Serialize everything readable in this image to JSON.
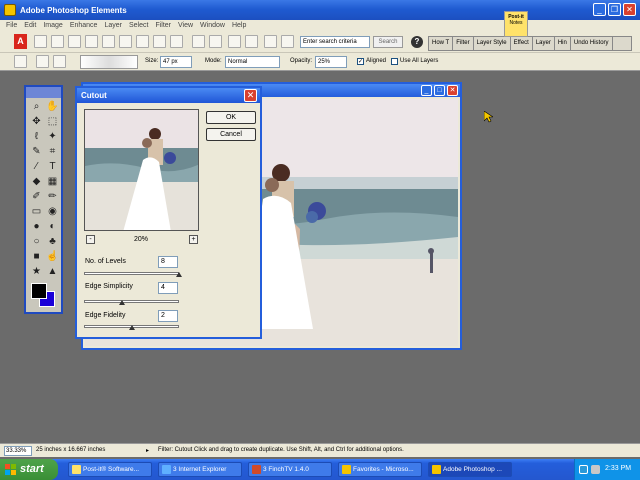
{
  "window": {
    "title": "Adobe Photoshop Elements"
  },
  "postit": {
    "label": "Post-it",
    "sub": "Notes"
  },
  "menubar": {
    "items": [
      "File",
      "Edit",
      "Image",
      "Enhance",
      "Layer",
      "Select",
      "Filter",
      "View",
      "Window",
      "Help"
    ]
  },
  "toolbar": {
    "search_placeholder": "Enter search criteria",
    "search_button": "Search",
    "help_glyph": "?",
    "palette_tabs": [
      "How T",
      "Filter",
      "Layer Style",
      "Effect",
      "Layer",
      "Hin",
      "Undo History"
    ]
  },
  "options": {
    "size_label": "Size:",
    "size_value": "47 px",
    "mode_label": "Mode:",
    "mode_value": "Normal",
    "opacity_label": "Opacity:",
    "opacity_value": "25%",
    "aligned_label": "Aligned",
    "aligned_checked": true,
    "use_all_layers_label": "Use All Layers",
    "use_all_layers_checked": false
  },
  "toolbox": {
    "tools": [
      "zoom-tool-icon",
      "hand-tool-icon",
      "move-tool-icon",
      "marquee-tool-icon",
      "lasso-tool-icon",
      "magic-wand-tool-icon",
      "selection-brush-icon",
      "crop-tool-icon",
      "eyedropper-icon",
      "type-tool-icon",
      "paint-bucket-icon",
      "gradient-tool-icon",
      "brush-tool-icon",
      "pencil-tool-icon",
      "eraser-tool-icon",
      "red-eye-tool-icon",
      "blur-tool-icon",
      "sponge-tool-icon",
      "dodge-tool-icon",
      "clone-stamp-icon",
      "shape-tool-icon",
      "smudge-tool-icon",
      "custom-shape-icon",
      "sharpen-tool-icon"
    ],
    "foreground_color": "#000000",
    "background_color": "#1a00d8"
  },
  "dialog": {
    "title": "Cutout",
    "ok_label": "OK",
    "cancel_label": "Cancel",
    "zoom_value": "20%",
    "zoom_minus": "-",
    "zoom_plus": "+",
    "params": [
      {
        "label": "No. of Levels",
        "value": "8",
        "slider_fraction": 1.0
      },
      {
        "label": "Edge Simplicity",
        "value": "4",
        "slider_fraction": 0.4
      },
      {
        "label": "Edge Fidelity",
        "value": "2",
        "slider_fraction": 0.5
      }
    ]
  },
  "statusbar": {
    "zoom": "33.33%",
    "dimensions": "25 inches x 16.667 inches",
    "arrow": "▸",
    "message": "Filter: Cutout   Click and drag to create duplicate. Use Shift, Alt, and Ctrl for additional options."
  },
  "taskbar": {
    "start_label": "start",
    "tasks": [
      {
        "label": "Post-it® Software...",
        "active": false
      },
      {
        "label": "3 Internet Explorer",
        "active": false
      },
      {
        "label": "3 FinchTV 1.4.0",
        "active": false
      },
      {
        "label": "Favorites - Microso...",
        "active": false
      },
      {
        "label": "Adobe Photoshop ...",
        "active": true
      }
    ],
    "clock": "2:33 PM"
  },
  "colors": {
    "xp_blue": "#245edb",
    "dialog_bg": "#ece9d8",
    "close_red": "#d9412f",
    "start_green": "#3a8f36"
  }
}
